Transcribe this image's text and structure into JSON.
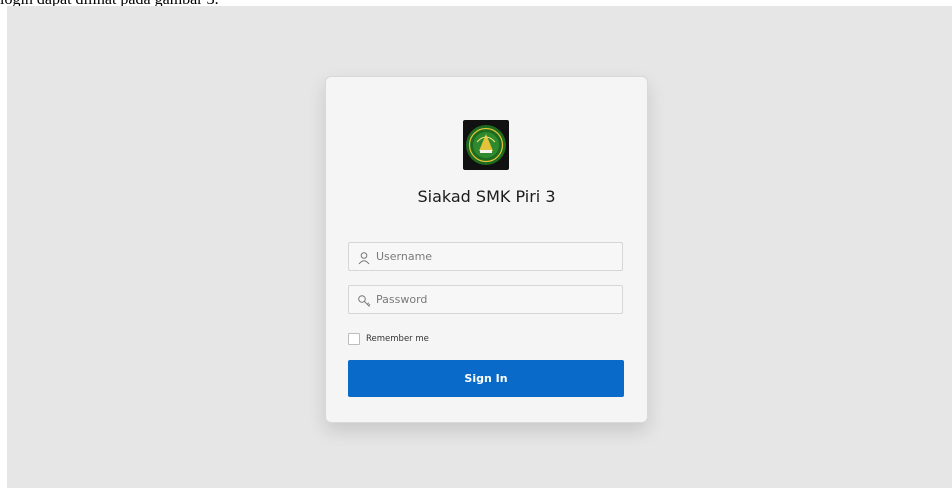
{
  "caption": "login dapat dilihat pada gambar 3.",
  "login": {
    "title": "Siakad SMK Piri 3",
    "logo_icon": "school-emblem-logo",
    "username": {
      "placeholder": "Username",
      "value": "",
      "icon": "user-icon"
    },
    "password": {
      "placeholder": "Password",
      "value": "",
      "icon": "key-icon"
    },
    "remember_label": "Remember me",
    "remember_checked": false,
    "signin_label": "Sign In"
  },
  "colors": {
    "background": "#e6e6e6",
    "card": "#f5f5f5",
    "primary": "#0a6ac9"
  }
}
